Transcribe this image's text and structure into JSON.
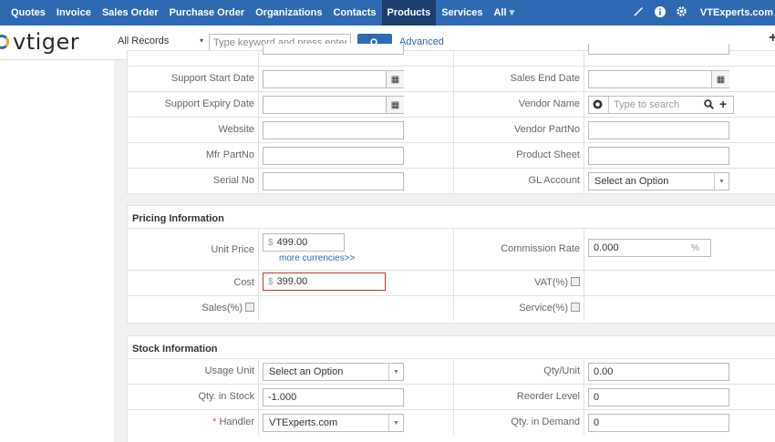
{
  "nav": {
    "items": [
      "Quotes",
      "Invoice",
      "Sales Order",
      "Purchase Order",
      "Organizations",
      "Contacts",
      "Products",
      "Services",
      "All"
    ],
    "active": "Products",
    "all_caret": "▾",
    "user": "VTExperts.com",
    "icons": [
      "pencil-icon",
      "info-icon",
      "gear-icon"
    ]
  },
  "subbar": {
    "logo_text": "vtiger",
    "records": "All Records",
    "records_caret": "▾",
    "search_placeholder": "Type keyword and press enter",
    "search_icon": "search-icon",
    "advanced": "Advanced",
    "plus": "+"
  },
  "info": {
    "support_start_date": "Support Start Date",
    "sales_end_date": "Sales End Date",
    "support_expiry_date": "Support Expiry Date",
    "vendor_name": "Vendor Name",
    "vendor_placeholder": "Type to search",
    "website": "Website",
    "vendor_partno": "Vendor PartNo",
    "mfr_partno": "Mfr PartNo",
    "product_sheet": "Product Sheet",
    "serial_no": "Serial No",
    "gl_account": "GL Account",
    "gl_account_value": "Select an Option"
  },
  "pricing": {
    "title": "Pricing Information",
    "unit_price_label": "Unit Price",
    "currency": "$",
    "unit_price": "499.00",
    "more_currencies": "more currencies>>",
    "commission_rate_label": "Commission Rate",
    "commission_rate": "0.000",
    "percent": "%",
    "cost_label": "Cost",
    "cost": "399.00",
    "vat_label": "VAT(%)",
    "sales_label": "Sales(%)",
    "service_label": "Service(%)"
  },
  "stock": {
    "title": "Stock Information",
    "usage_unit_label": "Usage Unit",
    "usage_unit_value": "Select an Option",
    "qty_unit_label": "Qty/Unit",
    "qty_unit": "0.00",
    "qty_in_stock_label": "Qty. in Stock",
    "qty_in_stock": "-1.000",
    "reorder_level_label": "Reorder Level",
    "reorder_level": "0",
    "required_mark": "*",
    "handler_label": "Handler",
    "handler_value": "VTExperts.com",
    "qty_in_demand_label": "Qty. in Demand",
    "qty_in_demand": "0"
  },
  "colors": {
    "nav_bg": "#2e6ab1",
    "nav_active": "#1c3f6e",
    "error_border": "#c0392b",
    "required": "#d9534f"
  }
}
